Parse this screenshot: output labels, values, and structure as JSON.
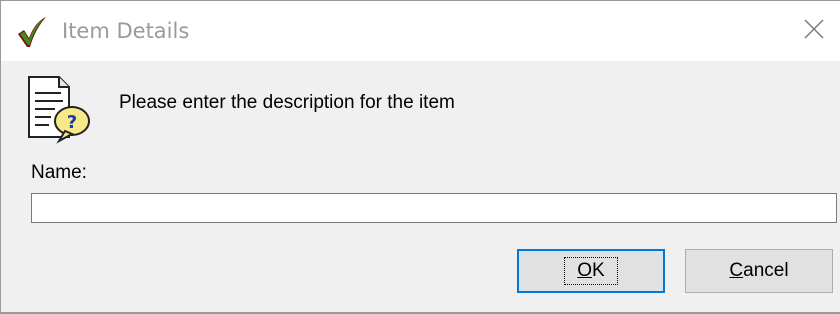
{
  "window": {
    "title": "Item Details",
    "close_glyph": "✕",
    "title_icon": "green-checkmark-icon",
    "close_icon": "close-icon"
  },
  "dialog": {
    "prompt_icon": "document-question-icon",
    "prompt": "Please enter the description for the item",
    "name_label": "Name:",
    "name_value": "",
    "name_placeholder": ""
  },
  "buttons": {
    "ok_mnemonic": "O",
    "ok_rest": "K",
    "cancel_mnemonic": "C",
    "cancel_rest": "ancel"
  },
  "colors": {
    "accent_focus": "#0078d7",
    "title_text": "#9a9a9a",
    "check_green": "#3c8c1e",
    "check_dark": "#7a1010"
  }
}
